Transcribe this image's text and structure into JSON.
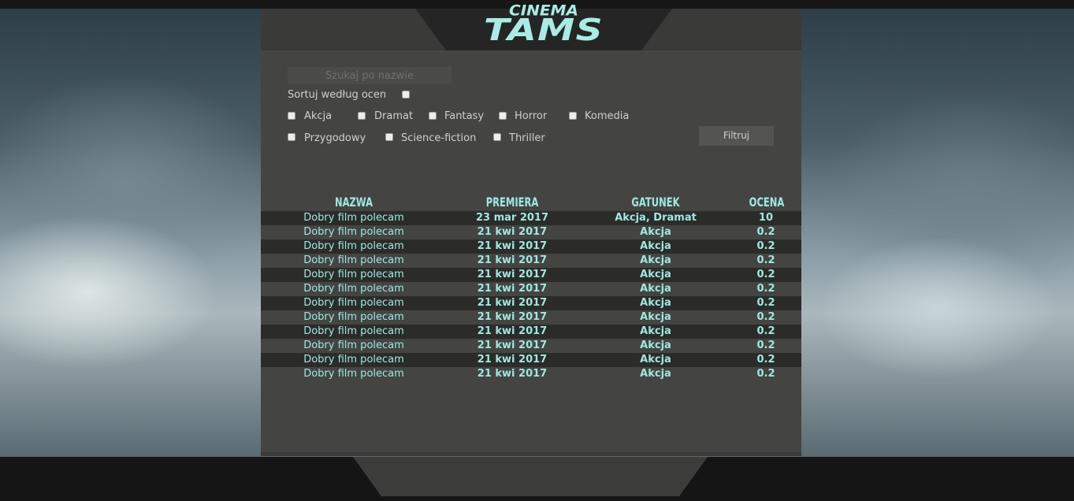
{
  "brand": {
    "logo_top": "CINEMA",
    "logo_main": "TAMS"
  },
  "controls": {
    "search_placeholder": "Szukaj po nazwie",
    "sort_label": "Sortuj według ocen",
    "filter_label": "Filtruj"
  },
  "genres": [
    "Akcja",
    "Dramat",
    "Fantasy",
    "Horror",
    "Komedia",
    "Przygodowy",
    "Science-fiction",
    "Thriller"
  ],
  "table": {
    "headers": [
      "NAZWA",
      "PREMIERA",
      "GATUNEK",
      "OCENA"
    ],
    "rows": [
      [
        "Dobry film polecam",
        "23 mar 2017",
        "Akcja, Dramat",
        "10"
      ],
      [
        "Dobry film polecam",
        "21 kwi 2017",
        "Akcja",
        "0.2"
      ],
      [
        "Dobry film polecam",
        "21 kwi 2017",
        "Akcja",
        "0.2"
      ],
      [
        "Dobry film polecam",
        "21 kwi 2017",
        "Akcja",
        "0.2"
      ],
      [
        "Dobry film polecam",
        "21 kwi 2017",
        "Akcja",
        "0.2"
      ],
      [
        "Dobry film polecam",
        "21 kwi 2017",
        "Akcja",
        "0.2"
      ],
      [
        "Dobry film polecam",
        "21 kwi 2017",
        "Akcja",
        "0.2"
      ],
      [
        "Dobry film polecam",
        "21 kwi 2017",
        "Akcja",
        "0.2"
      ],
      [
        "Dobry film polecam",
        "21 kwi 2017",
        "Akcja",
        "0.2"
      ],
      [
        "Dobry film polecam",
        "21 kwi 2017",
        "Akcja",
        "0.2"
      ],
      [
        "Dobry film polecam",
        "21 kwi 2017",
        "Akcja",
        "0.2"
      ],
      [
        "Dobry film polecam",
        "21 kwi 2017",
        "Akcja",
        "0.2"
      ]
    ]
  },
  "colors": {
    "accent": "#9fe8df",
    "panel": "#444443",
    "row_dark": "#2b2b2a"
  }
}
